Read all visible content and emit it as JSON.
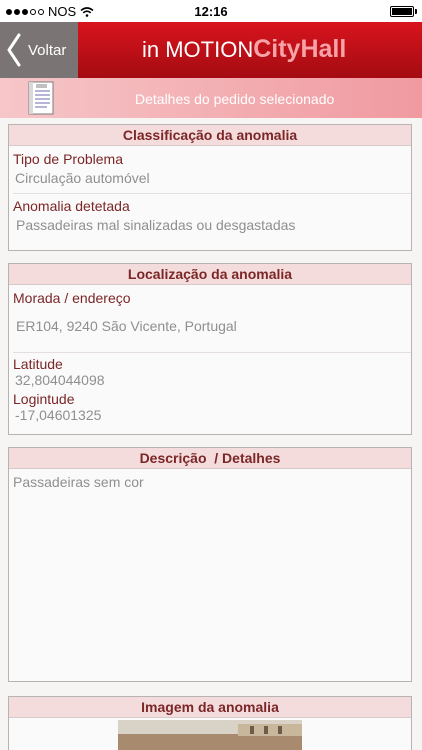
{
  "status_bar": {
    "carrier": "NOS",
    "time": "12:16"
  },
  "header": {
    "back_label": "Voltar",
    "title_prefix": "in MOTION",
    "title_brand": "CityHall"
  },
  "subheader": {
    "text": "Detalhes do pedido selecionado"
  },
  "classification": {
    "title": "Classificação da anomalia",
    "problem_type_label": "Tipo de Problema",
    "problem_type_value": "Circulação automóvel",
    "detected_label": "Anomalia detetada",
    "detected_value": "Passadeiras mal sinalizadas ou desgastadas"
  },
  "location": {
    "title": "Localização da anomalia",
    "address_label": "Morada / endereço",
    "address_value": "ER104, 9240 São Vicente, Portugal",
    "latitude_label": "Latitude",
    "latitude_value": "32,804044098",
    "longitude_label": "Logintude",
    "longitude_value": "-17,04601325"
  },
  "description": {
    "title": "Descrição  / Detalhes",
    "text": "Passadeiras sem cor"
  },
  "image": {
    "title": "Imagem da anomalia"
  }
}
